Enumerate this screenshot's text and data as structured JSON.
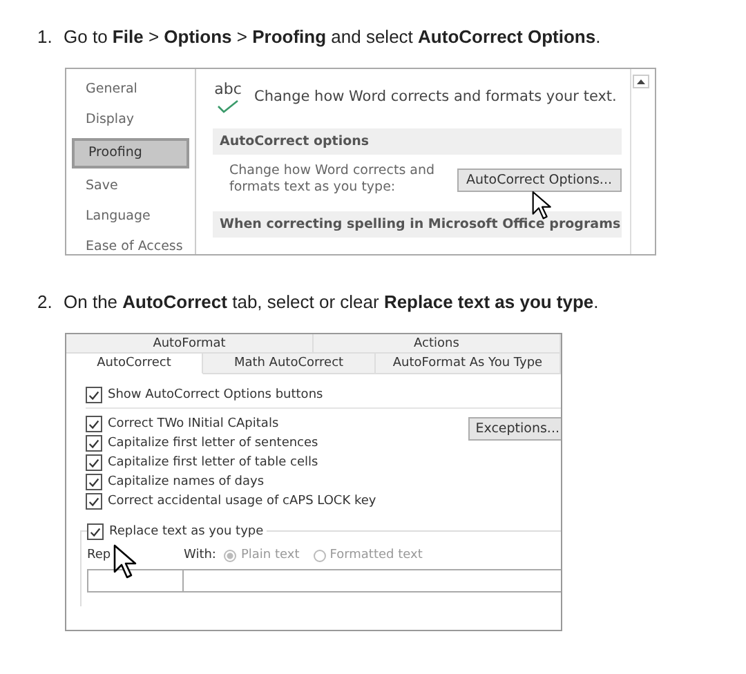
{
  "steps": [
    {
      "number": "1.",
      "text": "Go to **File** > **Options** > **Proofing** and select **AutoCorrect Options**."
    },
    {
      "number": "2.",
      "text": "On the **AutoCorrect** tab, select or clear **Replace text as you type**."
    }
  ],
  "options_dialog": {
    "nav": [
      {
        "label": "General",
        "selected": false
      },
      {
        "label": "Display",
        "selected": false
      },
      {
        "label": "Proofing",
        "selected": true
      },
      {
        "label": "Save",
        "selected": false
      },
      {
        "label": "Language",
        "selected": false
      },
      {
        "label": "Ease of Access",
        "selected": false
      }
    ],
    "icon_text": "abc",
    "intro": "Change how Word corrects and formats your text.",
    "sections": [
      {
        "heading": "AutoCorrect options",
        "description": "Change how Word corrects and formats text as you type:",
        "button": "AutoCorrect Options..."
      },
      {
        "heading": "When correcting spelling in Microsoft Office programs"
      }
    ]
  },
  "autocorrect_dialog": {
    "tab_rows": [
      [
        {
          "label": "AutoFormat",
          "selected": false
        },
        {
          "label": "Actions",
          "selected": false
        }
      ],
      [
        {
          "label": "AutoCorrect",
          "selected": true
        },
        {
          "label": "Math AutoCorrect",
          "selected": false
        },
        {
          "label": "AutoFormat As You Type",
          "selected": false
        }
      ]
    ],
    "show_buttons": {
      "label": "Show AutoCorrect Options buttons",
      "checked": true
    },
    "options": [
      {
        "label": "Correct TWo INitial CApitals",
        "checked": true
      },
      {
        "label": "Capitalize first letter of sentences",
        "checked": true
      },
      {
        "label": "Capitalize first letter of table cells",
        "checked": true
      },
      {
        "label": "Capitalize names of days",
        "checked": true
      },
      {
        "label": "Correct accidental usage of cAPS LOCK key",
        "checked": true
      }
    ],
    "exceptions_button": "Exceptions...",
    "replace": {
      "label": "Replace text as you type",
      "checked": true,
      "replace_label": "Rep",
      "with_label": "With:",
      "formats": [
        {
          "label": "Plain text",
          "selected": true
        },
        {
          "label": "Formatted text",
          "selected": false
        }
      ],
      "disabled": true
    }
  }
}
